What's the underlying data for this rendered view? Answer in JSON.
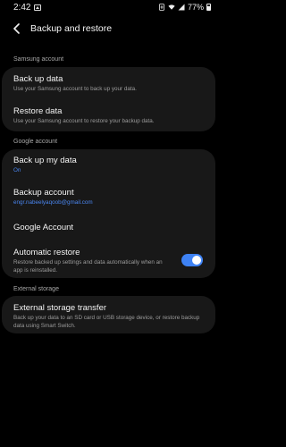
{
  "status_bar": {
    "time": "2:42",
    "battery_percent": "77%",
    "icons": [
      "image-icon",
      "battery-saver-icon",
      "wifi-icon",
      "signal-icon",
      "battery-icon"
    ]
  },
  "header": {
    "title": "Backup and restore",
    "back_icon": "back-arrow-icon"
  },
  "sections": {
    "samsung": {
      "label": "Samsung account",
      "items": [
        {
          "title": "Back up data",
          "subtitle": "Use your Samsung account to back up your data."
        },
        {
          "title": "Restore data",
          "subtitle": "Use your Samsung account to restore your backup data."
        }
      ]
    },
    "google": {
      "label": "Google account",
      "items": [
        {
          "title": "Back up my data",
          "subtitle": "On"
        },
        {
          "title": "Backup account",
          "subtitle": "engr.nabeelyaqoob@gmail.com"
        },
        {
          "title": "Google Account"
        },
        {
          "title": "Automatic restore",
          "subtitle": "Restore backed up settings and data automatically when an app is reinstalled.",
          "toggle": "on"
        }
      ]
    },
    "external": {
      "label": "External storage",
      "items": [
        {
          "title": "External storage transfer",
          "subtitle": "Back up your data to an SD card or USB storage device, or restore backup data using Smart Switch."
        }
      ]
    }
  },
  "colors": {
    "background": "#000000",
    "card": "#181818",
    "accent": "#3e82f4",
    "link_text": "#4a86f0"
  }
}
